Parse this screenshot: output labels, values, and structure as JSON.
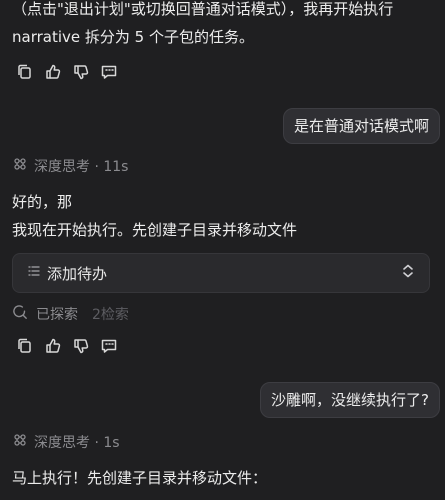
{
  "messages": {
    "assistant1": {
      "line1": "（点击\"退出计划\"或切换回普通对话模式），我再开始执行",
      "line2": "narrative 拆分为 5 个子包的任务。"
    },
    "user1": "是在普通对话模式啊",
    "think1": {
      "label": "深度思考 · 11s"
    },
    "assistant2": {
      "line1": "好的，那",
      "line2": "我现在开始执行。先创建子目录并移动文件"
    },
    "todo": {
      "label": "添加待办"
    },
    "search": {
      "label": "已探索",
      "count": "2检索"
    },
    "user2": "沙雕啊，没继续执行了?",
    "think2": {
      "label": "深度思考 · 1s"
    },
    "assistant3": {
      "line1": "马上执行！先创建子目录并移动文件："
    }
  },
  "icons": {
    "copy": "copy-icon",
    "like": "thumbs-up-icon",
    "dislike": "thumbs-down-icon",
    "feedback": "feedback-icon",
    "think": "brain-icon",
    "todo": "list-icon",
    "expand": "chevron-updown-icon",
    "search": "search-icon"
  },
  "colors": {
    "background": "#1f1f21",
    "bubble": "#2f2f33",
    "muted": "#8b8b8f"
  }
}
